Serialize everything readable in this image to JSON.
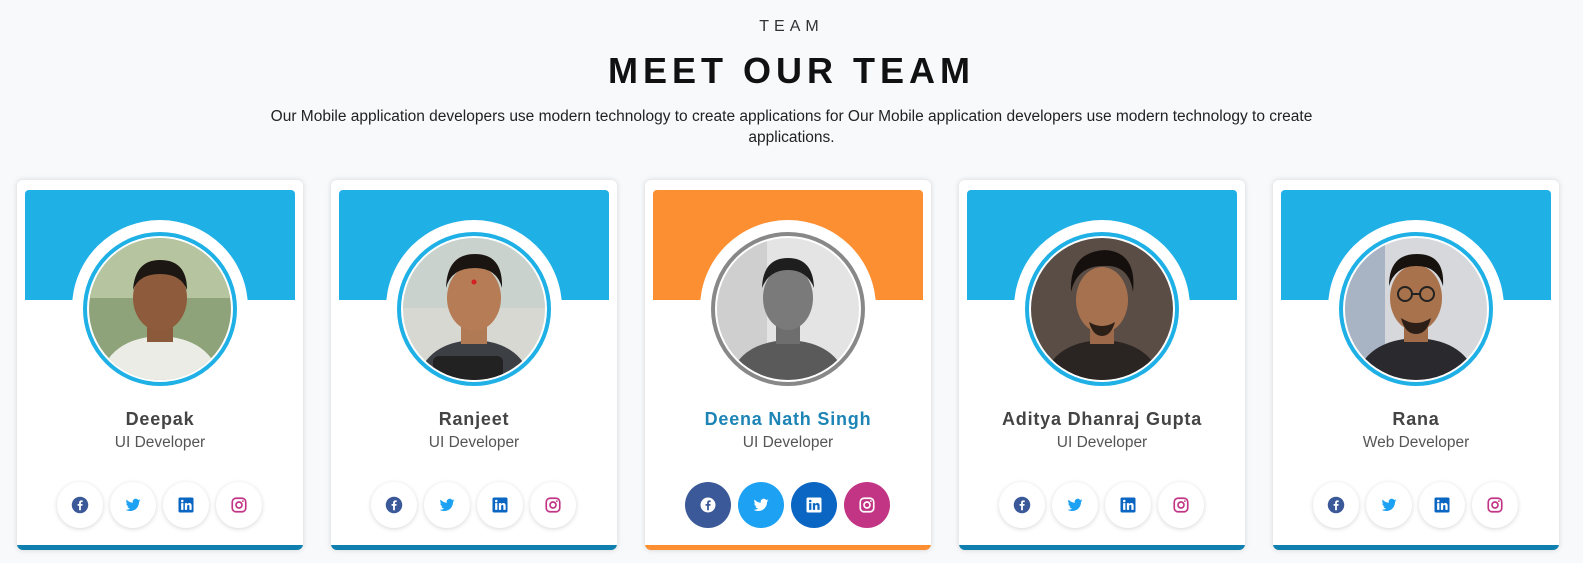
{
  "header": {
    "eyebrow": "TEAM",
    "title": "MEET OUR TEAM",
    "subtitle": "Our Mobile application developers use modern technology to create applications for Our Mobile application developers use modern technology to create applications."
  },
  "colors": {
    "band_default": "#1fb0e6",
    "band_active": "#fd8f33",
    "bottom_bar_default": "#0e7fae",
    "name_active": "#1d84b6",
    "facebook": "#3b5998",
    "twitter": "#1da1f2",
    "linkedin": "#0a66c2",
    "instagram": "#c13584"
  },
  "team": [
    {
      "name": "Deepak",
      "role": "UI Developer",
      "active": false
    },
    {
      "name": "Ranjeet",
      "role": "UI Developer",
      "active": false
    },
    {
      "name": "Deena Nath Singh",
      "role": "UI Developer",
      "active": true
    },
    {
      "name": "Aditya Dhanraj Gupta",
      "role": "UI Developer",
      "active": false
    },
    {
      "name": "Rana",
      "role": "Web Developer",
      "active": false
    }
  ],
  "social_icons": [
    "facebook-icon",
    "twitter-icon",
    "linkedin-icon",
    "instagram-icon"
  ]
}
